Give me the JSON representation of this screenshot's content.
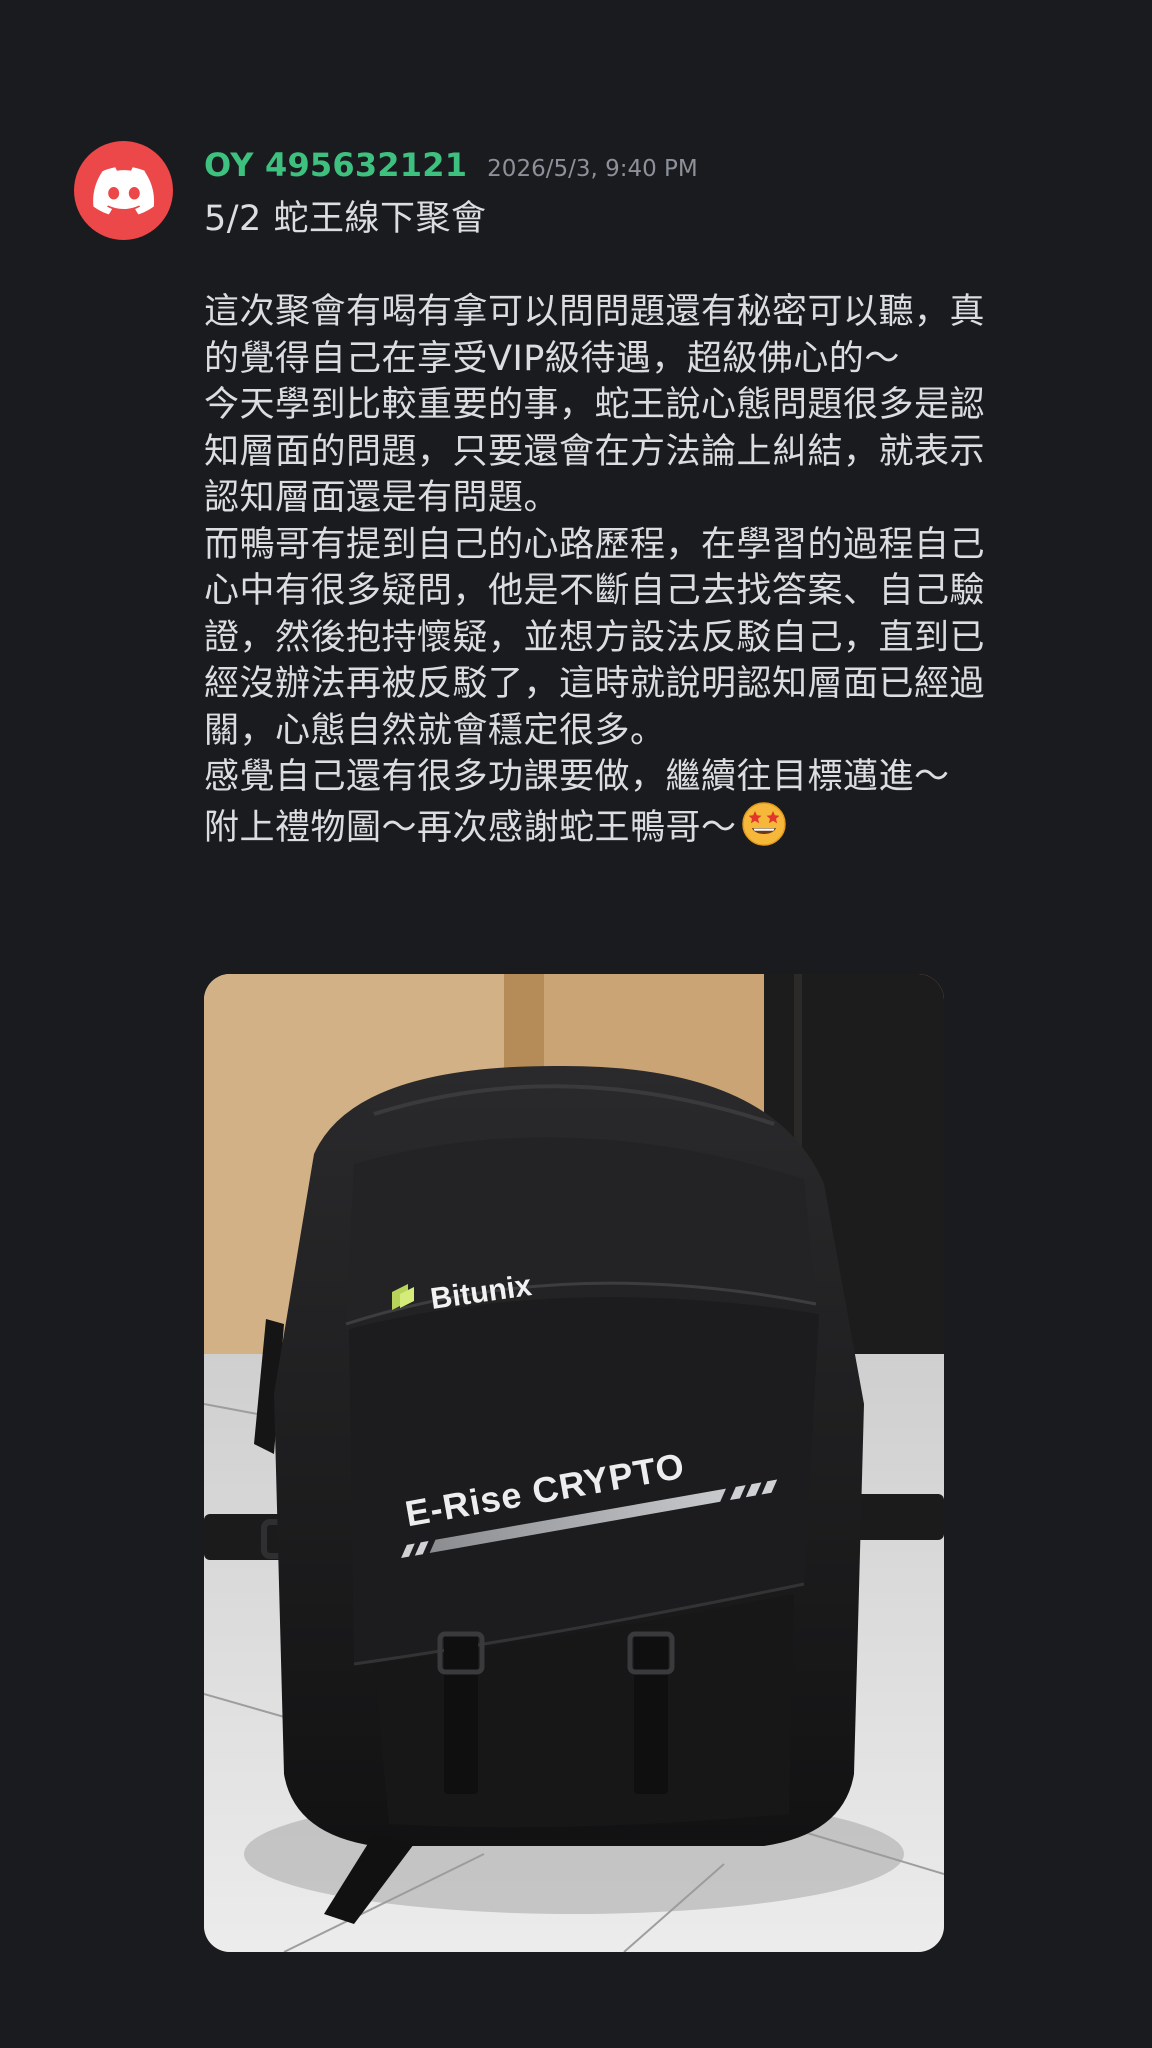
{
  "message": {
    "author": "OY 495632121",
    "timestamp": "2026/5/3, 9:40 PM",
    "avatar_icon": "discord-logo-icon",
    "avatar_color": "#ec4749",
    "username_color": "#3ec07f",
    "lines": [
      "5/2 蛇王線下聚會",
      "",
      "這次聚會有喝有拿可以問問題還有秘密可以聽，真",
      "的覺得自己在享受VIP級待遇，超級佛心的～",
      "今天學到比較重要的事，蛇王說心態問題很多是認",
      "知層面的問題，只要還會在方法論上糾結，就表示",
      "認知層面還是有問題。",
      "而鴨哥有提到自己的心路歷程，在學習的過程自己",
      "心中有很多疑問，他是不斷自己去找答案、自己驗",
      "證，然後抱持懷疑，並想方設法反駁自己，直到已",
      "經沒辦法再被反駁了，這時就說明認知層面已經過",
      "關，心態自然就會穩定很多。",
      "感覺自己還有很多功課要做，繼續往目標邁進～",
      "附上禮物圖～再次感謝蛇王鴨哥～"
    ],
    "trailing_emoji": "star-struck-emoji-icon"
  },
  "attachment": {
    "type": "photo",
    "subject": "black-backpack",
    "logo_text": "Bitunix",
    "print_text": "E-Rise CRYPTO"
  }
}
